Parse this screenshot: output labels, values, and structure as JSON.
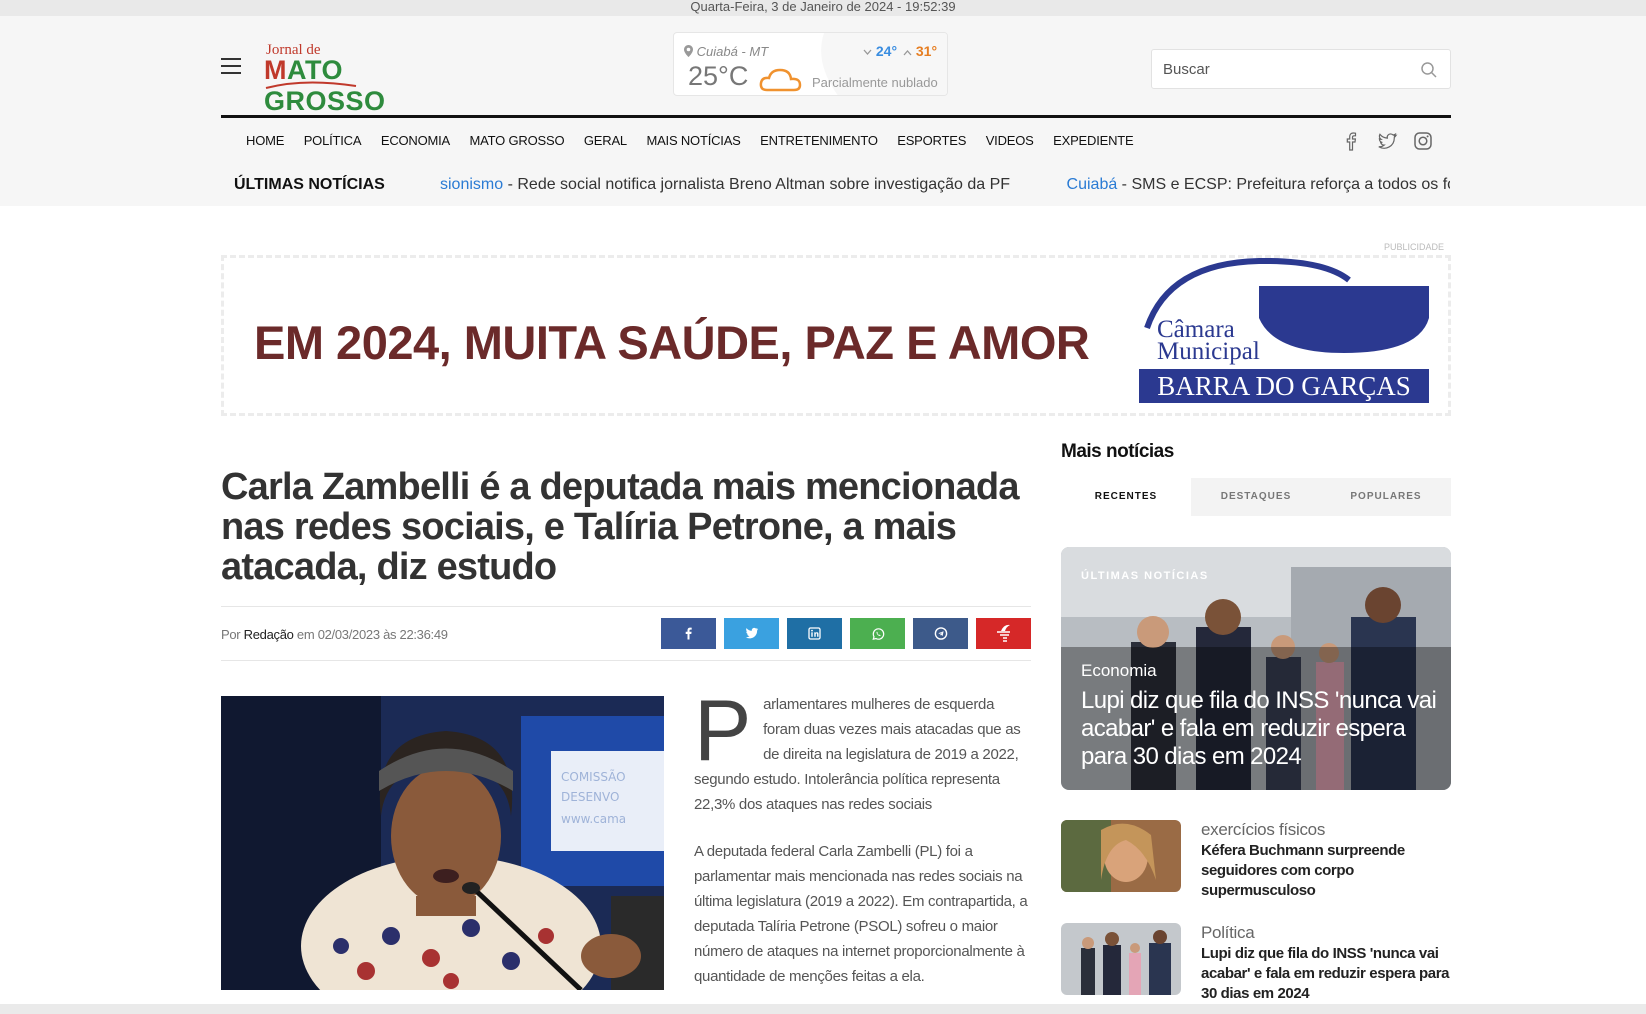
{
  "topbar": {
    "datetime": "Quarta-Feira, 3 de Janeiro de 2024 - 19:52:39"
  },
  "logo": {
    "small": "Jornal de",
    "big_m": "M",
    "big_rest": "ATO GROSSO"
  },
  "weather": {
    "location": "Cuiabá - MT",
    "temperature": "25°C",
    "min": "24°",
    "max": "31°",
    "description": "Parcialmente nublado",
    "icon": "cloud-sun-icon"
  },
  "search": {
    "placeholder": "Buscar",
    "value": ""
  },
  "nav": {
    "items": [
      "HOME",
      "POLÍTICA",
      "ECONOMIA",
      "MATO GROSSO",
      "GERAL",
      "MAIS NOTÍCIAS",
      "ENTRETENIMENTO",
      "ESPORTES",
      "VIDEOS",
      "EXPEDIENTE"
    ]
  },
  "social": [
    "facebook-icon",
    "twitter-icon",
    "instagram-icon"
  ],
  "ticker": {
    "label": "ÚLTIMAS NOTÍCIAS",
    "items": [
      {
        "tag": "sionismo",
        "text": " - Rede social notifica jornalista Breno Altman sobre investigação da PF"
      },
      {
        "tag": "Cuiabá",
        "text": " - SMS e ECSP: Prefeitura reforça a todos os fornecedor"
      }
    ]
  },
  "ad": {
    "label": "PUBLICIDADE",
    "slogan": "EM 2024, MUITA SAÚDE, PAZ E AMOR",
    "org_line1": "Câmara",
    "org_line2": "Municipal",
    "org_band": "BARRA DO GARÇAS",
    "colors": {
      "slogan": "#6b2a2a",
      "brand": "#2b3990"
    }
  },
  "article": {
    "title": "Carla Zambelli é a deputada mais mencionada nas redes sociais, e Talíria Petrone, a mais atacada, diz estudo",
    "by_prefix": "Por ",
    "author": "Redação",
    "date": " em 02/03/2023 às 22:36:49",
    "dropcap": "P",
    "lead": "arlamentares mulheres de esquerda foram duas vezes mais atacadas que as de direita na legislatura de 2019 a 2022, segundo estudo. Intolerância política representa 22,3% dos ataques nas redes sociais",
    "paragraph": "A deputada federal Carla Zambelli (PL) foi a parlamentar mais mencionada nas redes sociais na última legislatura (2019 a 2022). Em contrapartida, a deputada Talíria Petrone (PSOL) sofreu o maior número de ataques na internet proporcionalmente à quantidade de menções feitas a ela."
  },
  "share_buttons": [
    {
      "icon": "facebook-icon",
      "color": "#3b5998"
    },
    {
      "icon": "twitter-icon",
      "color": "#3aa1e0"
    },
    {
      "icon": "linkedin-icon",
      "color": "#1f6fa5"
    },
    {
      "icon": "whatsapp-icon",
      "color": "#4caf50"
    },
    {
      "icon": "telegram-icon",
      "color": "#3d5a8a"
    },
    {
      "icon": "gettr-icon",
      "color": "#d62828"
    }
  ],
  "sidebar": {
    "title": "Mais notícias",
    "tabs": [
      "RECENTES",
      "DESTAQUES",
      "POPULARES"
    ],
    "active_tab": "RECENTES",
    "feature": {
      "tag": "ÚLTIMAS NOTÍCIAS",
      "category": "Economia",
      "headline": "Lupi diz que fila do INSS 'nunca vai acabar' e fala em reduzir espera para 30 dias em 2024"
    },
    "items": [
      {
        "category": "exercícios físicos",
        "title": "Kéfera Buchmann surpreende seguidores com corpo supermusculoso"
      },
      {
        "category": "Política",
        "title": "Lupi diz que fila do INSS 'nunca vai acabar' e fala em reduzir espera para 30 dias em 2024"
      }
    ]
  }
}
